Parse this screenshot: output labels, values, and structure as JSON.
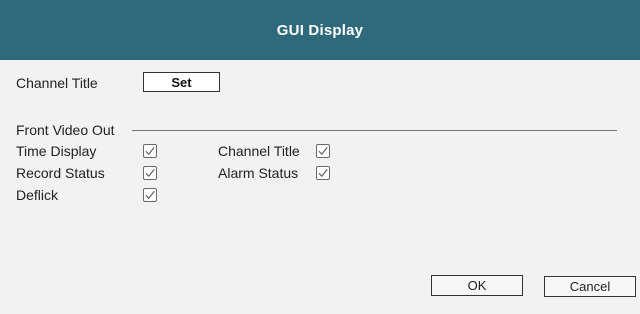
{
  "dialog": {
    "title": "GUI Display"
  },
  "channel_title_row": {
    "label": "Channel Title",
    "set_button_label": "Set"
  },
  "front_video_out": {
    "section_label": "Front Video Out",
    "options": {
      "time_display": {
        "label": "Time Display",
        "checked": true
      },
      "record_status": {
        "label": "Record Status",
        "checked": true
      },
      "deflick": {
        "label": "Deflick",
        "checked": true
      },
      "channel_title": {
        "label": "Channel Title",
        "checked": true
      },
      "alarm_status": {
        "label": "Alarm Status",
        "checked": true
      }
    }
  },
  "buttons": {
    "ok_label": "OK",
    "cancel_label": "Cancel"
  },
  "colors": {
    "titlebar": "#2e6a7c",
    "background": "#f2f2f2"
  },
  "icons": {
    "checkmark": "check-icon"
  }
}
